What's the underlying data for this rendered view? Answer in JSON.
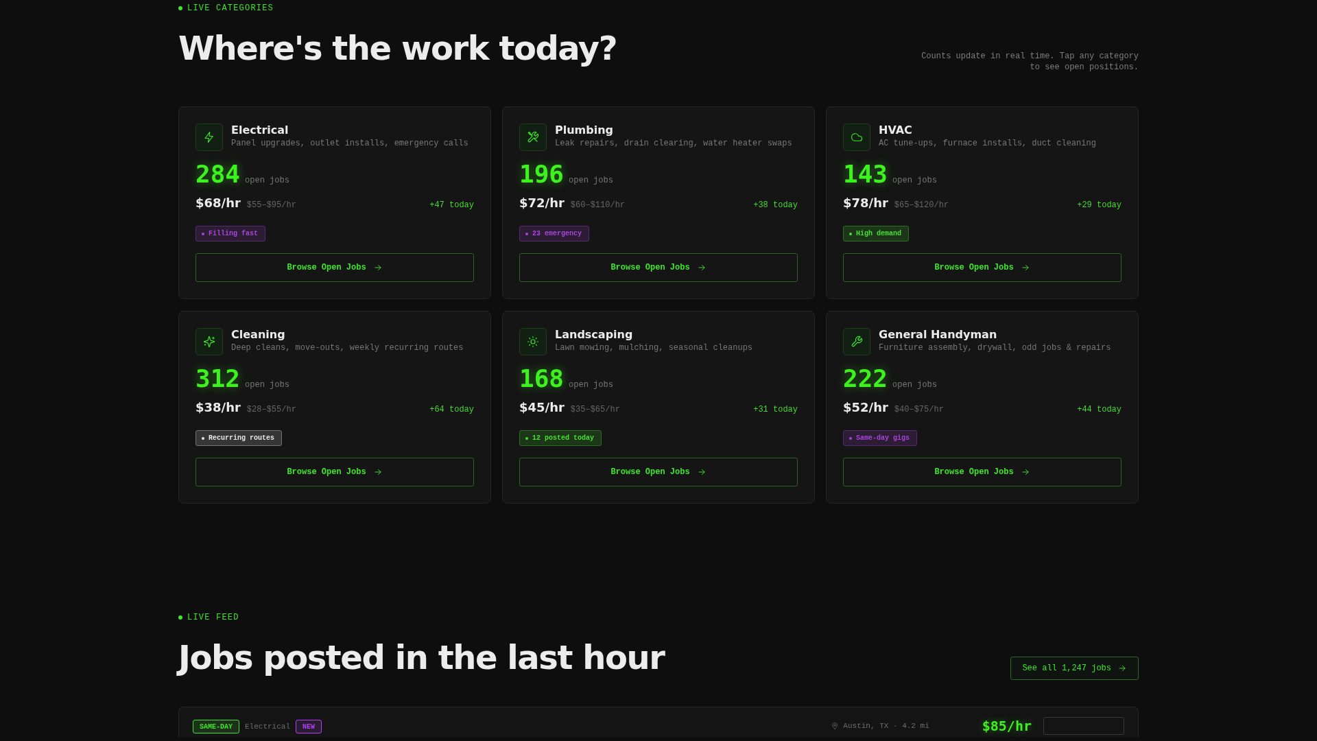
{
  "categories_header": {
    "eyebrow": "LIVE CATEGORIES",
    "title": "Where's the work today?",
    "note": "Counts update in real time. Tap any category to see open positions."
  },
  "categories": [
    {
      "name": "Electrical",
      "description": "Panel upgrades, outlet installs, emergency calls",
      "count": "284",
      "count_label": "open jobs",
      "rate": "$68/hr",
      "range": "$55–$95/hr",
      "today": "+47 today",
      "tag": {
        "label": "Filling fast",
        "color": "#a744dc"
      },
      "button": "Browse Open Jobs"
    },
    {
      "name": "Plumbing",
      "description": "Leak repairs, drain clearing, water heater swaps",
      "count": "196",
      "count_label": "open jobs",
      "rate": "$72/hr",
      "range": "$60–$110/hr",
      "today": "+38 today",
      "tag": {
        "label": "23 emergency",
        "color": "#a744dc"
      },
      "button": "Browse Open Jobs"
    },
    {
      "name": "HVAC",
      "description": "AC tune-ups, furnace installs, duct cleaning",
      "count": "143",
      "count_label": "open jobs",
      "rate": "$78/hr",
      "range": "$65–$120/hr",
      "today": "+29 today",
      "tag": {
        "label": "High demand",
        "color": "#44e030"
      },
      "button": "Browse Open Jobs"
    },
    {
      "name": "Cleaning",
      "description": "Deep cleans, move-outs, weekly recurring routes",
      "count": "312",
      "count_label": "open jobs",
      "rate": "$38/hr",
      "range": "$28–$55/hr",
      "today": "+64 today",
      "tag": {
        "label": "Recurring routes",
        "color": "#e6e6e6"
      },
      "button": "Browse Open Jobs"
    },
    {
      "name": "Landscaping",
      "description": "Lawn mowing, mulching, seasonal cleanups",
      "count": "168",
      "count_label": "open jobs",
      "rate": "$45/hr",
      "range": "$35–$65/hr",
      "today": "+31 today",
      "tag": {
        "label": "12 posted today",
        "color": "#44e030"
      },
      "button": "Browse Open Jobs"
    },
    {
      "name": "General Handyman",
      "description": "Furniture assembly, drywall, odd jobs & repairs",
      "count": "222",
      "count_label": "open jobs",
      "rate": "$52/hr",
      "range": "$40–$75/hr",
      "today": "+44 today",
      "tag": {
        "label": "Same-day gigs",
        "color": "#a744dc"
      },
      "button": "Browse Open Jobs"
    }
  ],
  "feed_header": {
    "eyebrow": "LIVE FEED",
    "title": "Jobs posted in the last hour",
    "link": "See all 1,247 jobs"
  },
  "jobs": [
    {
      "badge": {
        "label": "SAME-DAY",
        "color": "#44e030"
      },
      "category": "Electrical",
      "flag": {
        "label": "NEW",
        "color": "#b040f0"
      },
      "location": "Austin, TX · 4.2 mi",
      "rate": "$85/hr"
    }
  ]
}
